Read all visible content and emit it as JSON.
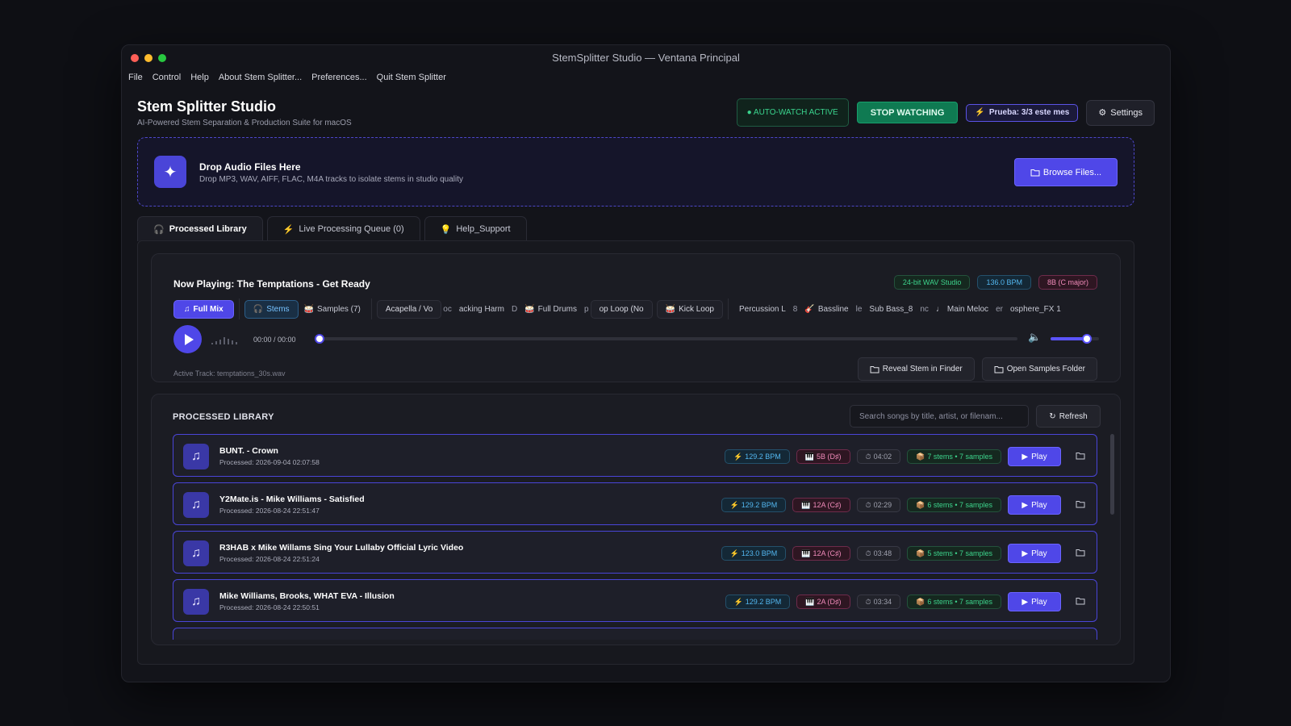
{
  "window": {
    "title": "StemSplitter Studio — Ventana Principal"
  },
  "menu": [
    "File",
    "Control",
    "Help",
    "About Stem Splitter...",
    "Preferences...",
    "Quit Stem Splitter"
  ],
  "header": {
    "title": "Stem Splitter Studio",
    "subtitle": "AI-Powered Stem Separation & Production Suite for macOS",
    "auto_watch": "● AUTO-WATCH ACTIVE",
    "stop_watching": "STOP WATCHING",
    "trial": "Prueba: 3/3 este mes",
    "settings": "Settings"
  },
  "dropzone": {
    "title": "Drop Audio Files Here",
    "subtitle": "Drop MP3, WAV, AIFF, FLAC, M4A tracks to isolate stems in studio quality",
    "browse": "Browse Files..."
  },
  "tabs": [
    {
      "label": "Processed Library",
      "icon": "headphones-icon"
    },
    {
      "label": "Live Processing Queue (0)",
      "icon": "bolt-icon"
    },
    {
      "label": "Help_Support",
      "icon": "lightbulb-icon"
    }
  ],
  "player": {
    "now_playing": "Now Playing: The Temptations - Get Ready",
    "badges": {
      "format": "24-bit WAV Studio",
      "bpm": "136.0 BPM",
      "key": "8B (C major)"
    },
    "modes": {
      "full_mix": "Full Mix",
      "stems": "Stems",
      "samples": "Samples (7)"
    },
    "stems": [
      "Acapella / Vo",
      "oc",
      "acking Harm",
      "D",
      "Full Drums",
      "p",
      "op Loop (No",
      "Kick Loop",
      "Percussion L",
      "8",
      "Bassline",
      "le",
      "Sub Bass_8",
      "nc",
      "Main Meloc",
      "er",
      "osphere_FX 1"
    ],
    "time": "00:00 / 00:00",
    "progress": 0,
    "volume": 0.75,
    "active_track": "Active Track: temptations_30s.wav",
    "reveal": "Reveal Stem in Finder",
    "open_samples": "Open Samples Folder"
  },
  "library": {
    "title": "PROCESSED LIBRARY",
    "search_placeholder": "Search songs by title, artist, or filenam...",
    "refresh": "Refresh",
    "items": [
      {
        "title": "BUNT. - Crown",
        "processed": "Processed: 2026-09-04 02:07:58",
        "bpm": "129.2 BPM",
        "key": "5B (D♯)",
        "duration": "04:02",
        "stems": "7 stems • 7 samples",
        "play": "Play"
      },
      {
        "title": "Y2Mate.is - Mike Williams - Satisfied",
        "processed": "Processed: 2026-08-24 22:51:47",
        "bpm": "129.2 BPM",
        "key": "12A (C♯)",
        "duration": "02:29",
        "stems": "6 stems • 7 samples",
        "play": "Play"
      },
      {
        "title": "R3HAB x Mike Willams  Sing Your Lullaby Official Lyric Video",
        "processed": "Processed: 2026-08-24 22:51:24",
        "bpm": "123.0 BPM",
        "key": "12A (C♯)",
        "duration": "03:48",
        "stems": "5 stems • 7 samples",
        "play": "Play"
      },
      {
        "title": "Mike Williams, Brooks, WHAT EVA - Illusion",
        "processed": "Processed: 2026-08-24 22:50:51",
        "bpm": "129.2 BPM",
        "key": "2A (D♯)",
        "duration": "03:34",
        "stems": "6 stems • 7 samples",
        "play": "Play"
      }
    ]
  },
  "colors": {
    "accent": "#4f47e8",
    "green": "#3ad48d",
    "bpm": "#53b7f0",
    "key": "#f08ab9"
  }
}
